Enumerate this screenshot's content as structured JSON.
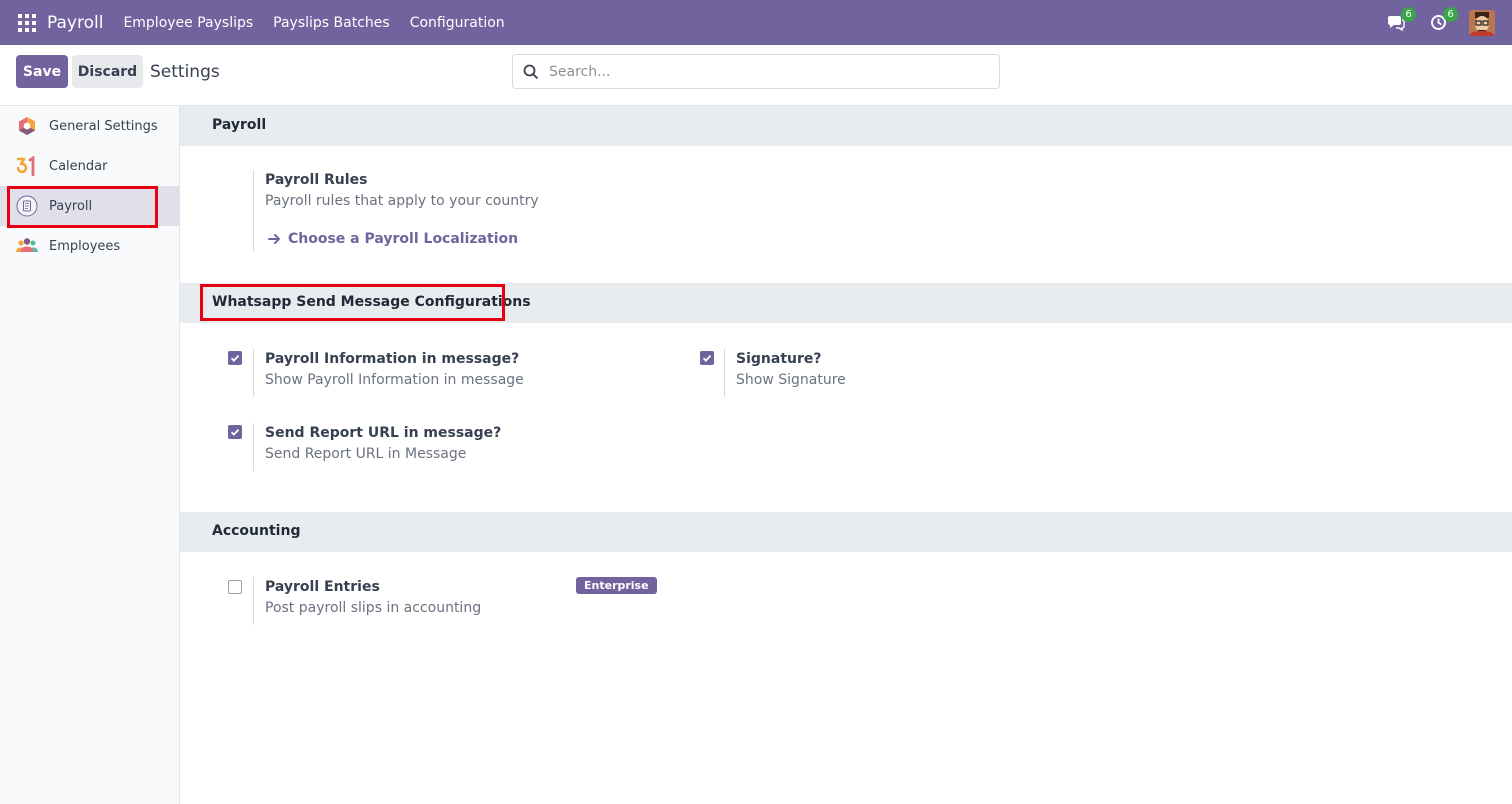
{
  "navbar": {
    "brand": "Payroll",
    "menu": [
      "Employee Payslips",
      "Payslips Batches",
      "Configuration"
    ],
    "messages_count": "6",
    "activities_count": "6"
  },
  "control": {
    "save_label": "Save",
    "discard_label": "Discard",
    "breadcrumb": "Settings",
    "search_placeholder": "Search..."
  },
  "sidebar": {
    "items": [
      {
        "label": "General Settings",
        "icon": "odoo-logo-icon"
      },
      {
        "label": "Calendar",
        "icon": "calendar-icon"
      },
      {
        "label": "Payroll",
        "icon": "payroll-icon"
      },
      {
        "label": "Employees",
        "icon": "employees-icon"
      }
    ],
    "active_index": 2
  },
  "sections": {
    "payroll": {
      "title": "Payroll",
      "rules_title": "Payroll Rules",
      "rules_desc": "Payroll rules that apply to your country",
      "link_label": "Choose a Payroll Localization"
    },
    "whatsapp": {
      "title": "Whatsapp Send Message Configurations",
      "settings": [
        {
          "title": "Payroll Information in message?",
          "desc": "Show Payroll Information in message",
          "checked": true
        },
        {
          "title": "Signature?",
          "desc": "Show Signature",
          "checked": true
        },
        {
          "title": "Send Report URL in message?",
          "desc": "Send Report URL in Message",
          "checked": true
        }
      ]
    },
    "accounting": {
      "title": "Accounting",
      "entries_title": "Payroll Entries",
      "entries_desc": "Post payroll slips in accounting",
      "entries_checked": false,
      "badge": "Enterprise"
    }
  },
  "colors": {
    "brand": "#71639e",
    "highlight": "#e60012",
    "badge_green": "#3aa54a"
  }
}
